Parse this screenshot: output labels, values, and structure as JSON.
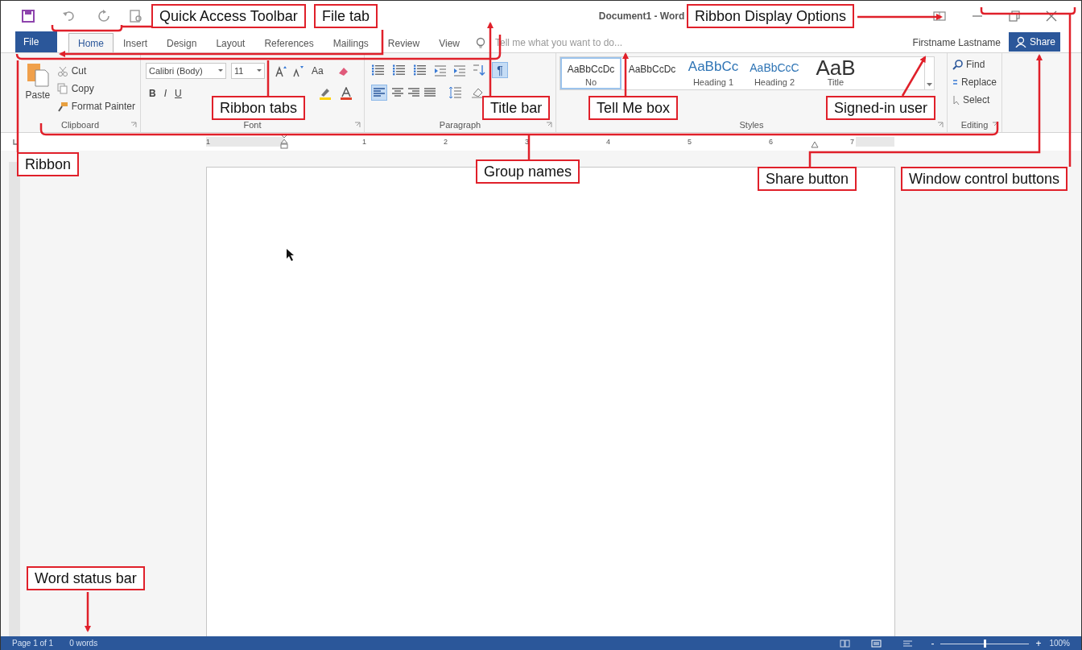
{
  "title_bar": {
    "title": "Document1 - Word"
  },
  "tabs": [
    {
      "label": "File",
      "kind": "file",
      "selected": false
    },
    {
      "label": "Home",
      "kind": "tab",
      "selected": true
    },
    {
      "label": "Insert",
      "kind": "tab",
      "selected": false
    },
    {
      "label": "Design",
      "kind": "tab",
      "selected": false
    },
    {
      "label": "Layout",
      "kind": "tab",
      "selected": false
    },
    {
      "label": "References",
      "kind": "tab",
      "selected": false
    },
    {
      "label": "Mailings",
      "kind": "tab",
      "selected": false
    },
    {
      "label": "Review",
      "kind": "tab",
      "selected": false
    },
    {
      "label": "View",
      "kind": "tab",
      "selected": false
    }
  ],
  "tell_me": {
    "placeholder": "Tell me what you want to do..."
  },
  "user": "Firstname Lastname",
  "share_button": "Share",
  "ribbon": {
    "clipboard": {
      "paste": "Paste",
      "cut": "Cut",
      "copy": "Copy",
      "format_painter": "Format Painter",
      "group": "Clipboard"
    },
    "font": {
      "font_name": "Calibri (Body)",
      "font_size": "11",
      "change_case": "Aa",
      "bold": "B",
      "italic": "I",
      "underline": "U",
      "group": "Font"
    },
    "paragraph": {
      "show_marks": {
        "glyph": "¶",
        "on": true
      },
      "align_left_on": true,
      "group": "Paragraph"
    },
    "styles": {
      "items": [
        {
          "sample": "AaBbCcDc",
          "label": "No",
          "kind": "normal",
          "selected": true
        },
        {
          "sample": "AaBbCcDc",
          "kind": "normal",
          "selected": false
        },
        {
          "sample": "AaBbCc",
          "label": "Heading 1",
          "kind": "heading1",
          "selected": false
        },
        {
          "sample": "AaBbCcC",
          "label": "Heading 2",
          "kind": "heading2",
          "selected": false
        },
        {
          "sample": "AaB",
          "label": "Title",
          "kind": "title",
          "selected": false
        }
      ],
      "group": "Styles"
    },
    "editing": {
      "find": "Find",
      "replace": "Replace",
      "select": "Select",
      "group": "Editing"
    }
  },
  "ruler": [
    "1",
    "1",
    "2",
    "3",
    "4",
    "5",
    "6",
    "7"
  ],
  "status_bar": {
    "page": "Page 1 of 1",
    "words": "0 words",
    "zoom_out": "-",
    "zoom_in": "+",
    "zoom": {
      "level": 0.5
    },
    "zoom_percent": "100%"
  },
  "callouts": [
    {
      "text": "Quick Access Toolbar"
    },
    {
      "text": "File tab"
    },
    {
      "text": "Ribbon Display Options"
    },
    {
      "text": "Ribbon tabs"
    },
    {
      "text": "Title bar"
    },
    {
      "text": "Tell Me box"
    },
    {
      "text": "Signed-in user"
    },
    {
      "text": "Ribbon"
    },
    {
      "text": "Group names"
    },
    {
      "text": "Share button"
    },
    {
      "text": "Window control buttons"
    },
    {
      "text": "Word status bar"
    }
  ]
}
